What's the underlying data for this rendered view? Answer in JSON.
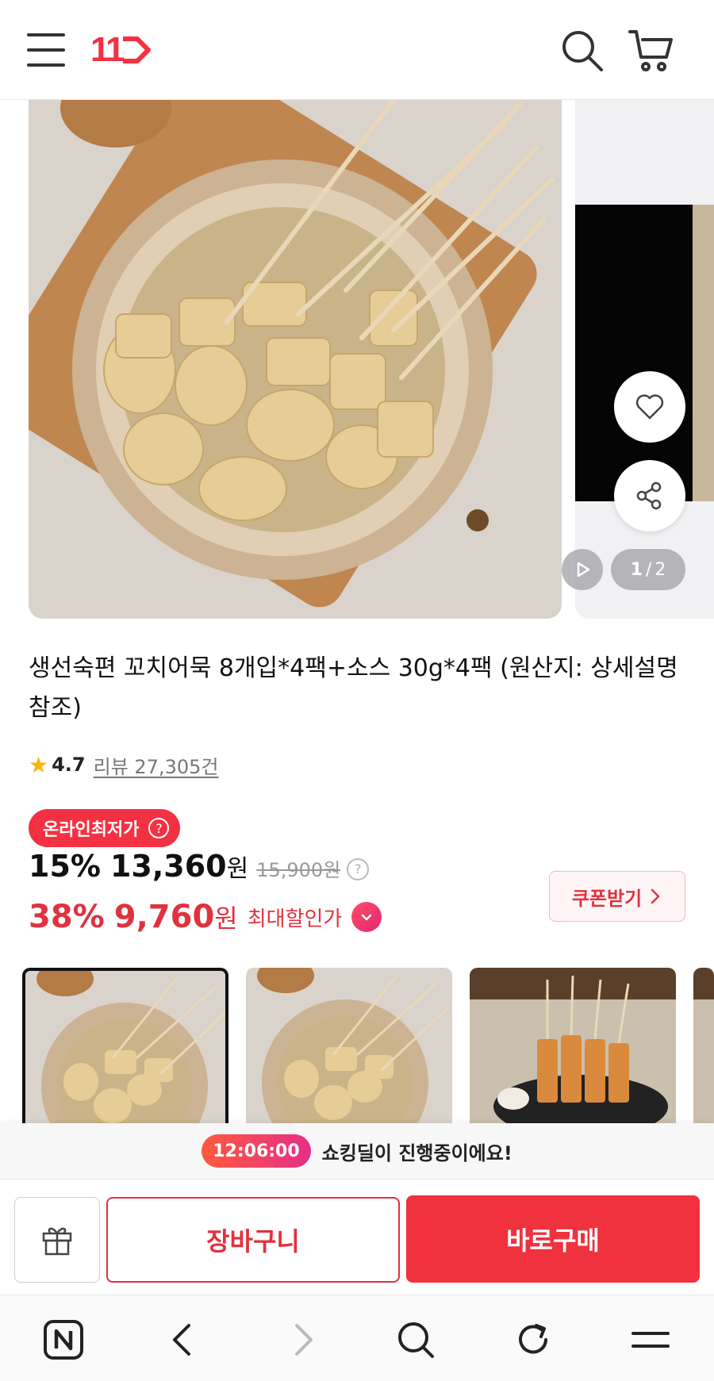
{
  "header": {
    "logo_text": "11",
    "icons": [
      "hamburger-menu-icon",
      "search-icon",
      "cart-icon"
    ]
  },
  "gallery": {
    "pager_current": "1",
    "pager_total": "2",
    "pager_separator": "/"
  },
  "product": {
    "title": "생선숙편 꼬치어묵 8개입*4팩+소스 30g*4팩 (원산지: 상세설명 참조)",
    "rating": "4.7",
    "review_label": "리뷰 27,305건"
  },
  "price": {
    "badge": "온라인최저가",
    "discount": "15%",
    "sale_price": "13,360",
    "won": "원",
    "original_price": "15,900원",
    "max_discount": "38%",
    "max_price": "9,760",
    "max_label": "최대할인가",
    "coupon_button": "쿠폰받기"
  },
  "deal_bar": {
    "timer": "12:06:00",
    "text": "쇼킹딜이 진행중이에요!"
  },
  "actions": {
    "cart_button": "장바구니",
    "buy_button": "바로구매"
  },
  "colors": {
    "brand_red": "#f43142",
    "price_red": "#e0323e"
  }
}
